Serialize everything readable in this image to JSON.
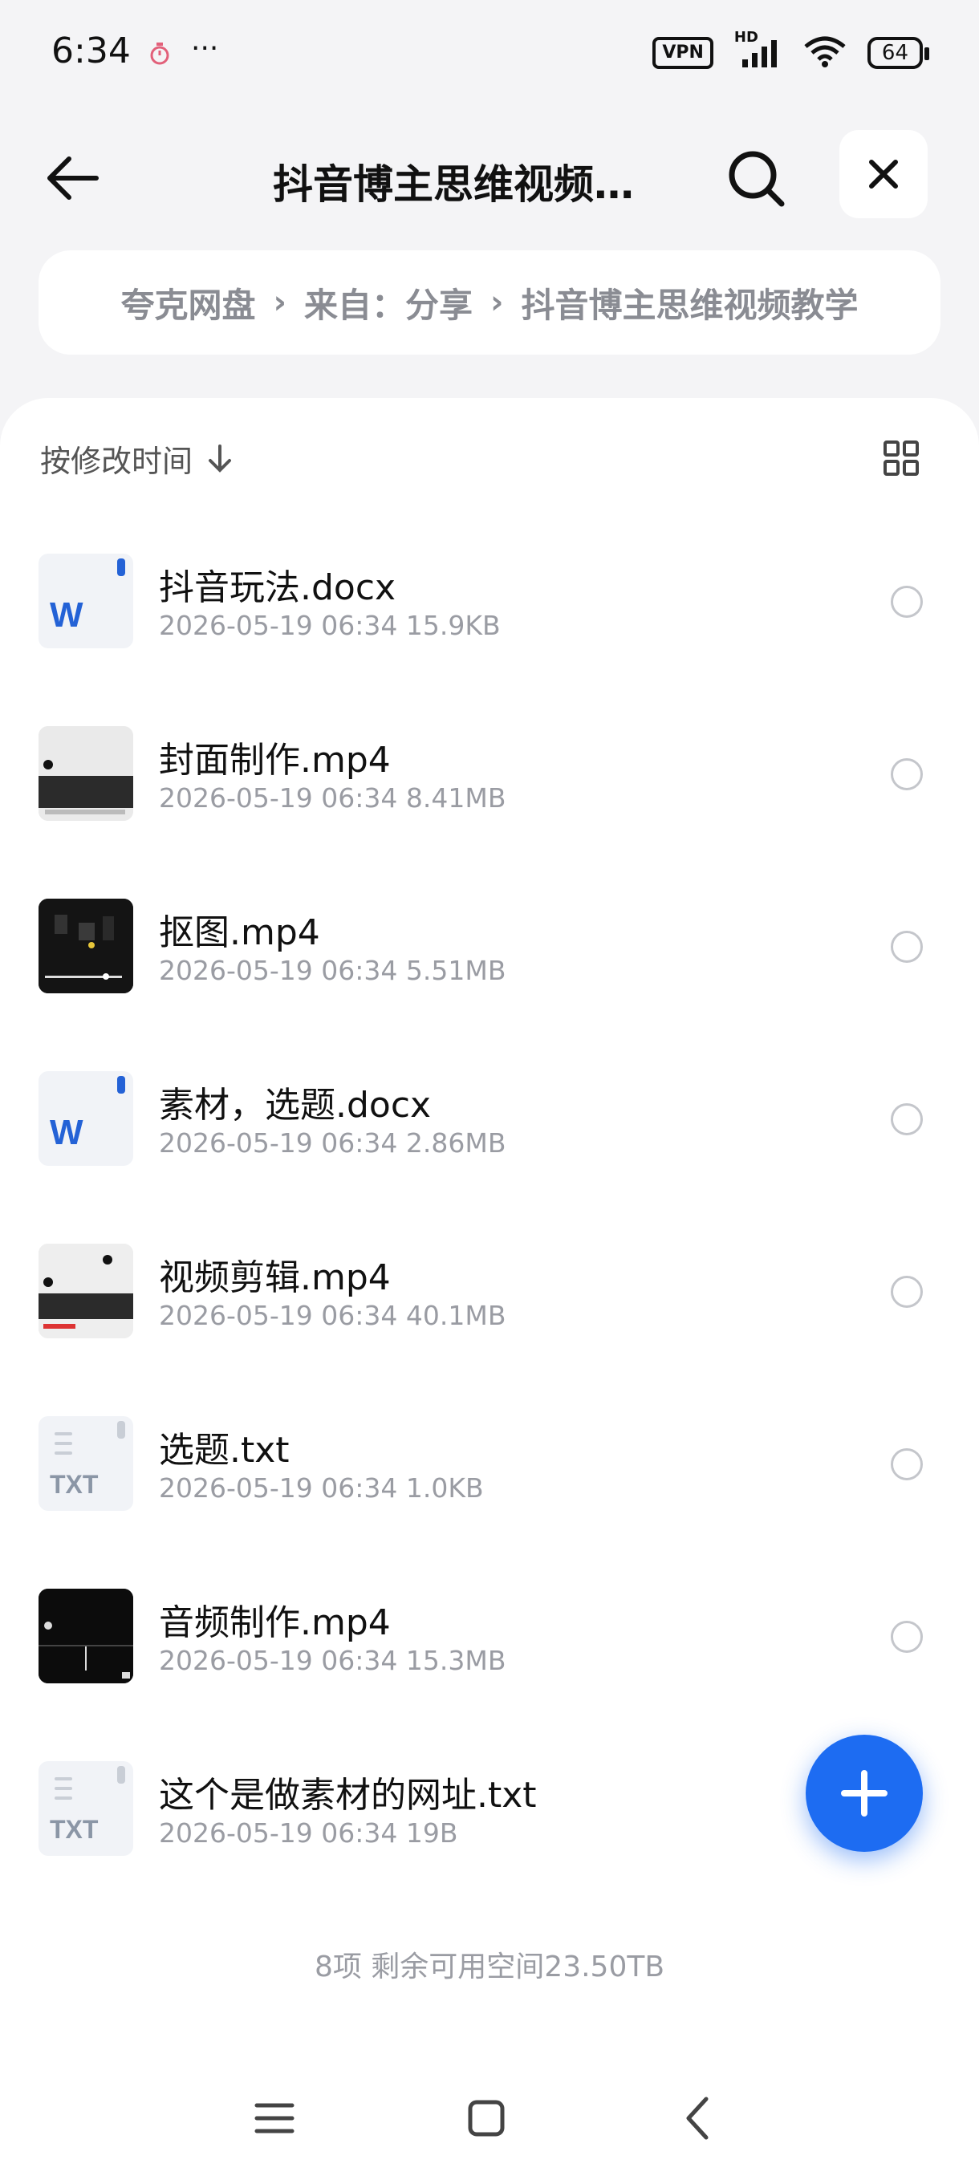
{
  "status_bar": {
    "time": "6:34",
    "more": "···",
    "vpn": "VPN",
    "hd": "HD",
    "battery": "64"
  },
  "header": {
    "title": "抖音博主思维视频…"
  },
  "breadcrumb": {
    "items": [
      "夸克网盘",
      "来自：分享",
      "抖音博主思维视频教学"
    ]
  },
  "sort": {
    "label": "按修改时间"
  },
  "files": [
    {
      "name": "抖音玩法.docx",
      "date": "2026-05-19 06:34",
      "size": "15.9KB",
      "type": "docx"
    },
    {
      "name": "封面制作.mp4",
      "date": "2026-05-19 06:34",
      "size": "8.41MB",
      "type": "video"
    },
    {
      "name": "抠图.mp4",
      "date": "2026-05-19 06:34",
      "size": "5.51MB",
      "type": "video"
    },
    {
      "name": "素材，选题.docx",
      "date": "2026-05-19 06:34",
      "size": "2.86MB",
      "type": "docx"
    },
    {
      "name": "视频剪辑.mp4",
      "date": "2026-05-19 06:34",
      "size": "40.1MB",
      "type": "video"
    },
    {
      "name": "选题.txt",
      "date": "2026-05-19 06:34",
      "size": "1.0KB",
      "type": "txt"
    },
    {
      "name": "音频制作.mp4",
      "date": "2026-05-19 06:34",
      "size": "15.3MB",
      "type": "video"
    },
    {
      "name": "这个是做素材的网址.txt",
      "date": "2026-05-19 06:34",
      "size": "19B",
      "type": "txt"
    }
  ],
  "icons": {
    "docx_letter": "W",
    "txt_label": "TXT"
  },
  "footer": {
    "summary": "8项 剩余可用空间23.50TB"
  },
  "colors": {
    "accent": "#1d6cf2",
    "word_blue": "#2462d6"
  }
}
